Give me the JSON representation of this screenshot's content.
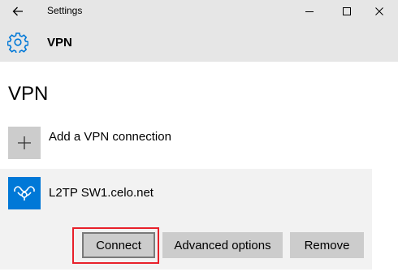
{
  "window": {
    "title": "Settings",
    "icons": {
      "back": "arrow-left-icon",
      "minimize": "minimize-icon",
      "maximize": "maximize-icon",
      "close": "close-icon"
    }
  },
  "header": {
    "icon": "gear-icon",
    "title": "VPN"
  },
  "page": {
    "title": "VPN"
  },
  "add_connection": {
    "icon": "plus-icon",
    "label": "Add a VPN connection"
  },
  "connections": [
    {
      "icon": "vpn-icon",
      "name": "L2TP SW1.celo.net",
      "actions": {
        "connect": "Connect",
        "advanced": "Advanced options",
        "remove": "Remove"
      }
    }
  ],
  "colors": {
    "accent": "#0078d7",
    "titlebar": "#e6e6e6",
    "panel": "#f2f2f2",
    "button": "#cccccc",
    "highlight": "#e8202a"
  }
}
